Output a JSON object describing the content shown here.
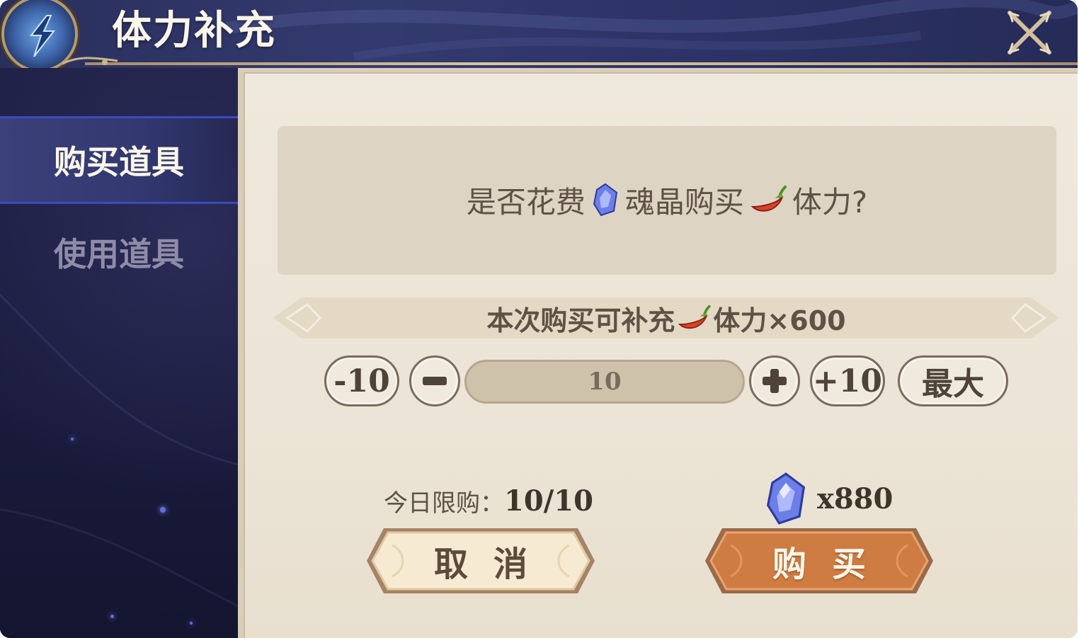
{
  "header": {
    "title": "体力补充",
    "emblem_icon": "lightning-emblem-icon",
    "close_icon": "close-icon"
  },
  "sidebar": {
    "tabs": [
      {
        "label": "购买道具",
        "active": true
      },
      {
        "label": "使用道具",
        "active": false
      }
    ]
  },
  "dialog": {
    "question": {
      "prefix": "是否花费",
      "currency_name": "魂晶购买",
      "suffix": "体力?",
      "currency_icon": "soul-crystal-icon",
      "stamina_icon": "stamina-pepper-icon"
    },
    "replenish": {
      "prefix": "本次购买可补充",
      "suffix": "体力×600",
      "icon": "stamina-pepper-icon"
    },
    "quantity": {
      "minus10_label": "-10",
      "minus_label": "−",
      "value": "10",
      "plus_label": "+",
      "plus10_label": "+10",
      "max_label": "最大"
    },
    "daily_limit": {
      "label": "今日限购：",
      "value": "10/10"
    },
    "cost": {
      "icon": "soul-crystal-icon",
      "value": "x880"
    },
    "buttons": {
      "cancel_label": "取消",
      "buy_label": "购买"
    }
  },
  "colors": {
    "header_bg": "#2d3366",
    "sidebar_bg": "#1c1f42",
    "panel_bg": "#ece4d6",
    "accent_blue": "#3d4bbd",
    "buy_orange": "#c7743a",
    "cancel_cream": "#f3e6cc",
    "text_brown": "#5e5246"
  }
}
